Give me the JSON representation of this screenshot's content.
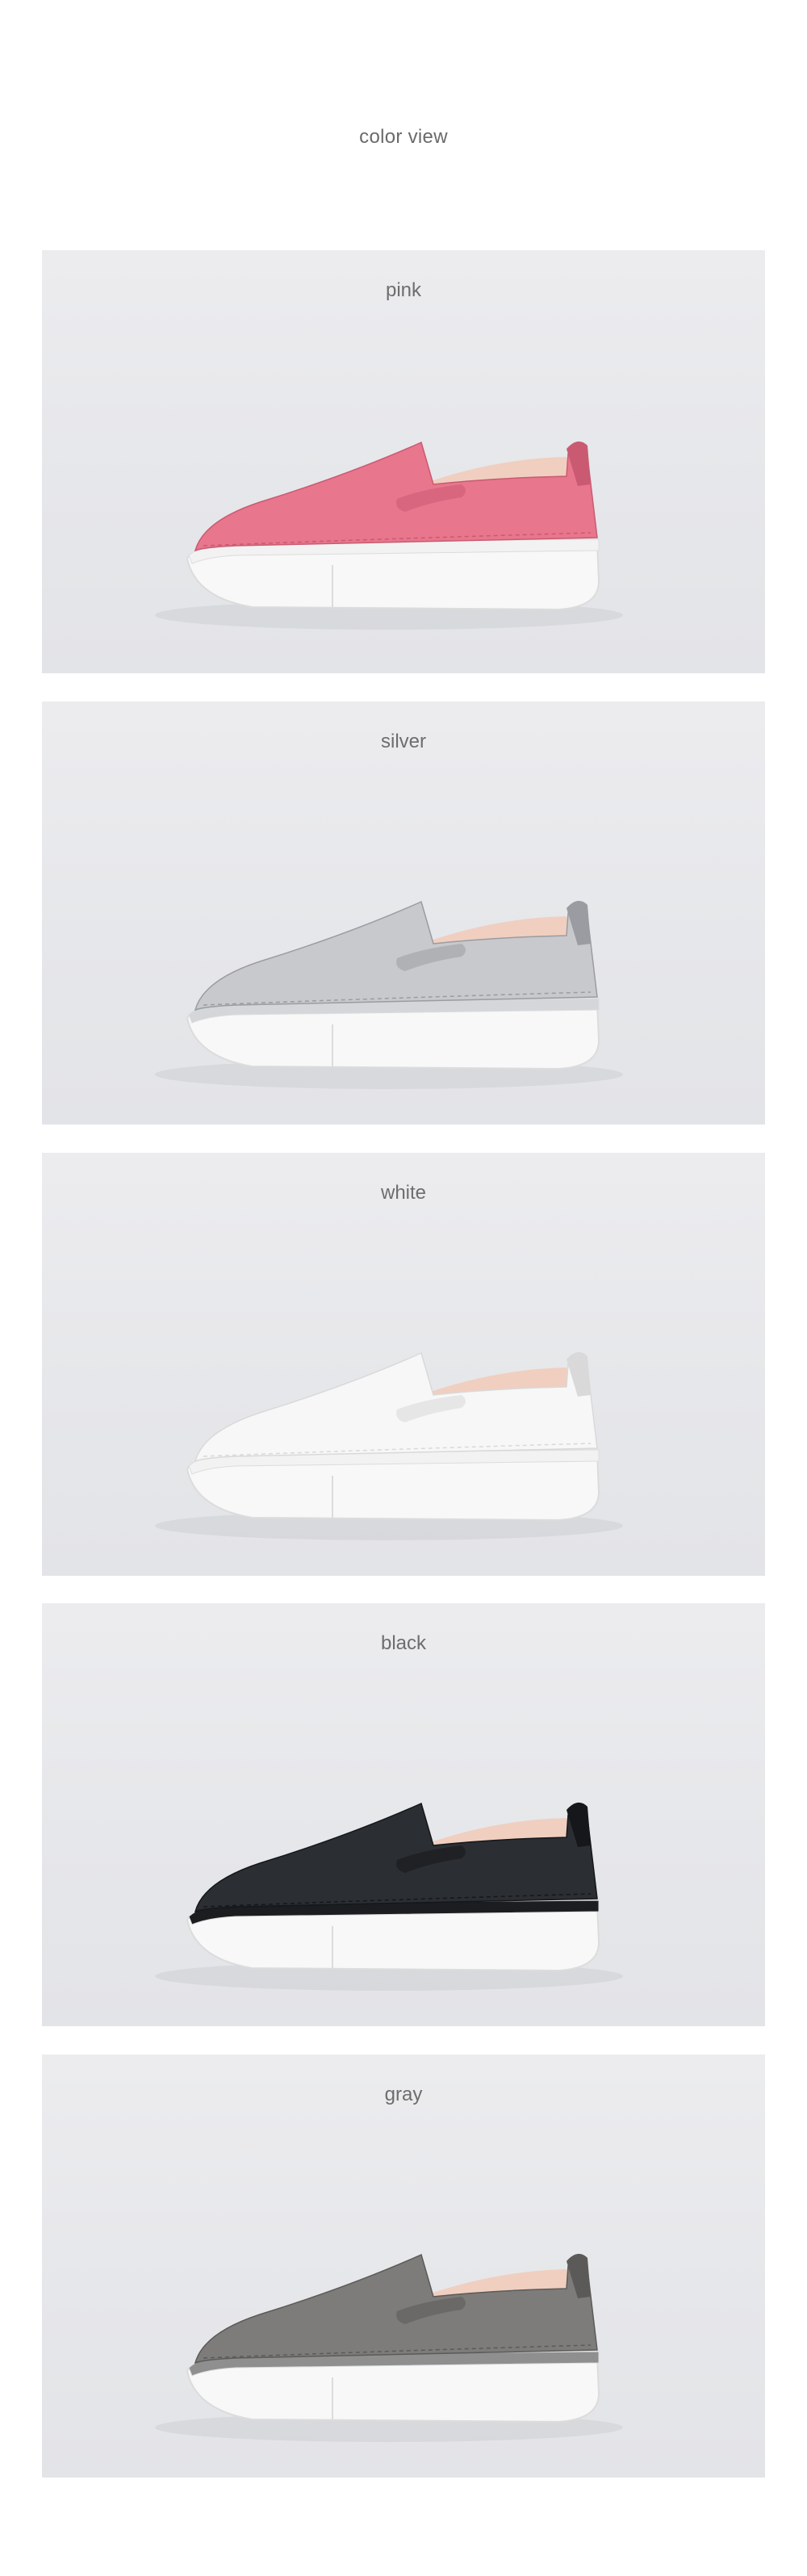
{
  "heading": "color view",
  "variants": [
    {
      "label": "pink",
      "upper": "#e8768c",
      "shade": "#c95a72",
      "sole_rim": "#f2f2f2"
    },
    {
      "label": "silver",
      "upper": "#c8c9cc",
      "shade": "#9a9ca1",
      "sole_rim": "#d4d6da"
    },
    {
      "label": "white",
      "upper": "#f7f7f7",
      "shade": "#d9d9d9",
      "sole_rim": "#f2f2f2"
    },
    {
      "label": "black",
      "upper": "#2b2e33",
      "shade": "#15171a",
      "sole_rim": "#1c1d20"
    },
    {
      "label": "gray",
      "upper": "#7d7c7a",
      "shade": "#5b5a58",
      "sole_rim": "#8f8f8f"
    }
  ],
  "colors": {
    "lining": "#f0cfc0",
    "sole": "#f8f8f8",
    "sole_shadow": "#dcdcdc"
  }
}
